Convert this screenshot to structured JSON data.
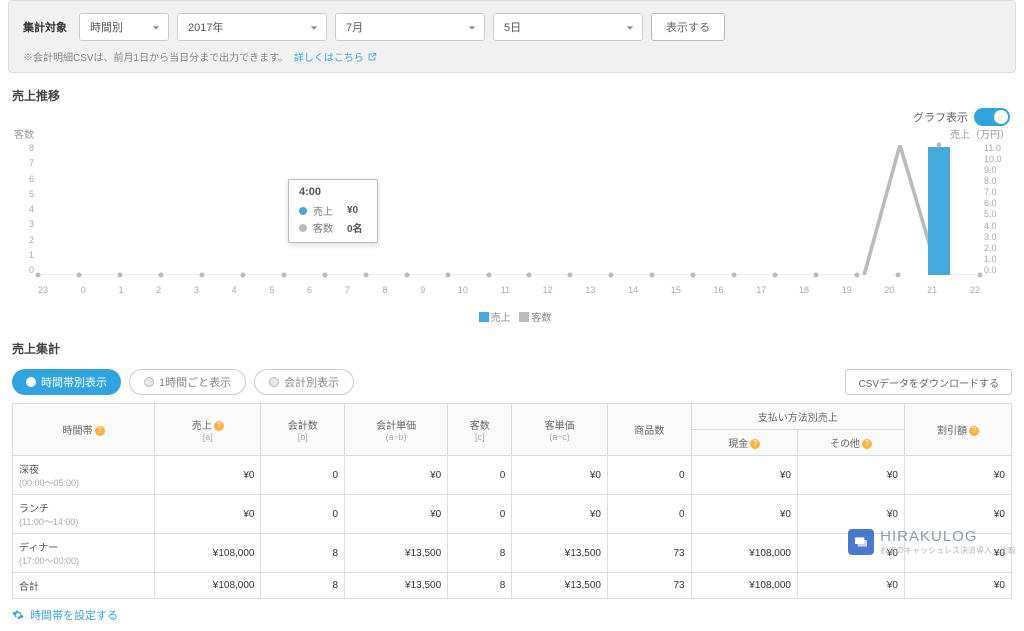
{
  "filter": {
    "label": "集計対象",
    "target": "時間別",
    "year": "2017年",
    "month": "7月",
    "day": "5日",
    "show_btn": "表示する",
    "note_prefix": "※会計明細CSVは、前月1日から当日分まで出力できます。",
    "note_link": "詳しくはこちら"
  },
  "chart": {
    "section_title": "売上推移",
    "left_axis_label": "客数",
    "right_axis_label": "売上（万円）",
    "toggle_label": "グラフ表示",
    "y_left": [
      "8",
      "7",
      "6",
      "5",
      "4",
      "3",
      "2",
      "1",
      "0"
    ],
    "y_right": [
      "11.0",
      "10.0",
      "9.0",
      "8.0",
      "7.0",
      "6.0",
      "5.0",
      "4.0",
      "3.0",
      "2.0",
      "1.0",
      "0.0"
    ],
    "x_labels": [
      "23",
      "0",
      "1",
      "2",
      "3",
      "4",
      "5",
      "6",
      "7",
      "8",
      "9",
      "10",
      "11",
      "12",
      "13",
      "14",
      "15",
      "16",
      "17",
      "18",
      "19",
      "20",
      "21",
      "22"
    ],
    "legend_sales": "売上",
    "legend_guests": "客数",
    "tooltip": {
      "title": "4:00",
      "sales_label": "売上",
      "sales_value": "¥0",
      "guests_label": "客数",
      "guests_value": "0名"
    }
  },
  "chart_data": {
    "type": "bar",
    "categories": [
      "23",
      "0",
      "1",
      "2",
      "3",
      "4",
      "5",
      "6",
      "7",
      "8",
      "9",
      "10",
      "11",
      "12",
      "13",
      "14",
      "15",
      "16",
      "17",
      "18",
      "19",
      "20",
      "21",
      "22"
    ],
    "series": [
      {
        "name": "売上",
        "unit": "万円",
        "axis": "right",
        "values": [
          0,
          0,
          0,
          0,
          0,
          0,
          0,
          0,
          0,
          0,
          0,
          0,
          0,
          0,
          0,
          0,
          0,
          0,
          0,
          0,
          0,
          0,
          10.8,
          0
        ]
      },
      {
        "name": "客数",
        "unit": "名",
        "axis": "left",
        "values": [
          0,
          0,
          0,
          0,
          0,
          0,
          0,
          0,
          0,
          0,
          0,
          0,
          0,
          0,
          0,
          0,
          0,
          0,
          0,
          0,
          0,
          0,
          8,
          0
        ]
      }
    ],
    "xlabel": "",
    "ylabel_left": "客数",
    "ylabel_right": "売上（万円）",
    "ylim_left": [
      0,
      8
    ],
    "ylim_right": [
      0,
      11
    ]
  },
  "summary": {
    "section_title": "売上集計",
    "tabs": {
      "timeband": "時間帯別表示",
      "hourly": "1時間ごと表示",
      "perbill": "会計別表示"
    },
    "csv_btn": "CSVデータをダウンロードする",
    "columns": {
      "timeband": "時間帯",
      "sales": "売上",
      "sales_sub": "[a]",
      "bills": "会計数",
      "bills_sub": "[b]",
      "bill_avg": "会計単価",
      "bill_avg_sub": "(a÷b)",
      "guests": "客数",
      "guests_sub": "[c]",
      "guest_avg": "客単価",
      "guest_avg_sub": "(a÷c)",
      "items": "商品数",
      "pay_group": "支払い方法別売上",
      "cash": "現金",
      "other": "その他",
      "discount": "割引額"
    },
    "rows": [
      {
        "label": "深夜",
        "range": "(00:00〜05:00)",
        "sales": "¥0",
        "bills": "0",
        "bill_avg": "¥0",
        "guests": "0",
        "guest_avg": "¥0",
        "items": "0",
        "cash": "¥0",
        "other": "¥0",
        "discount": "¥0"
      },
      {
        "label": "ランチ",
        "range": "(11:00〜14:00)",
        "sales": "¥0",
        "bills": "0",
        "bill_avg": "¥0",
        "guests": "0",
        "guest_avg": "¥0",
        "items": "0",
        "cash": "¥0",
        "other": "¥0",
        "discount": "¥0"
      },
      {
        "label": "ディナー",
        "range": "(17:00〜00:00)",
        "sales": "¥108,000",
        "bills": "8",
        "bill_avg": "¥13,500",
        "guests": "8",
        "guest_avg": "¥13,500",
        "items": "73",
        "cash": "¥108,000",
        "other": "¥0",
        "discount": "¥0"
      },
      {
        "label": "合計",
        "range": "",
        "sales": "¥108,000",
        "bills": "8",
        "bill_avg": "¥13,500",
        "guests": "8",
        "guest_avg": "¥13,500",
        "items": "73",
        "cash": "¥108,000",
        "other": "¥0",
        "discount": "¥0"
      }
    ],
    "foot_link": "時間帯を設定する"
  },
  "brand": {
    "name": "HIRAKULOG",
    "sub": "お店のキャッシュレス決済導入・比較"
  }
}
